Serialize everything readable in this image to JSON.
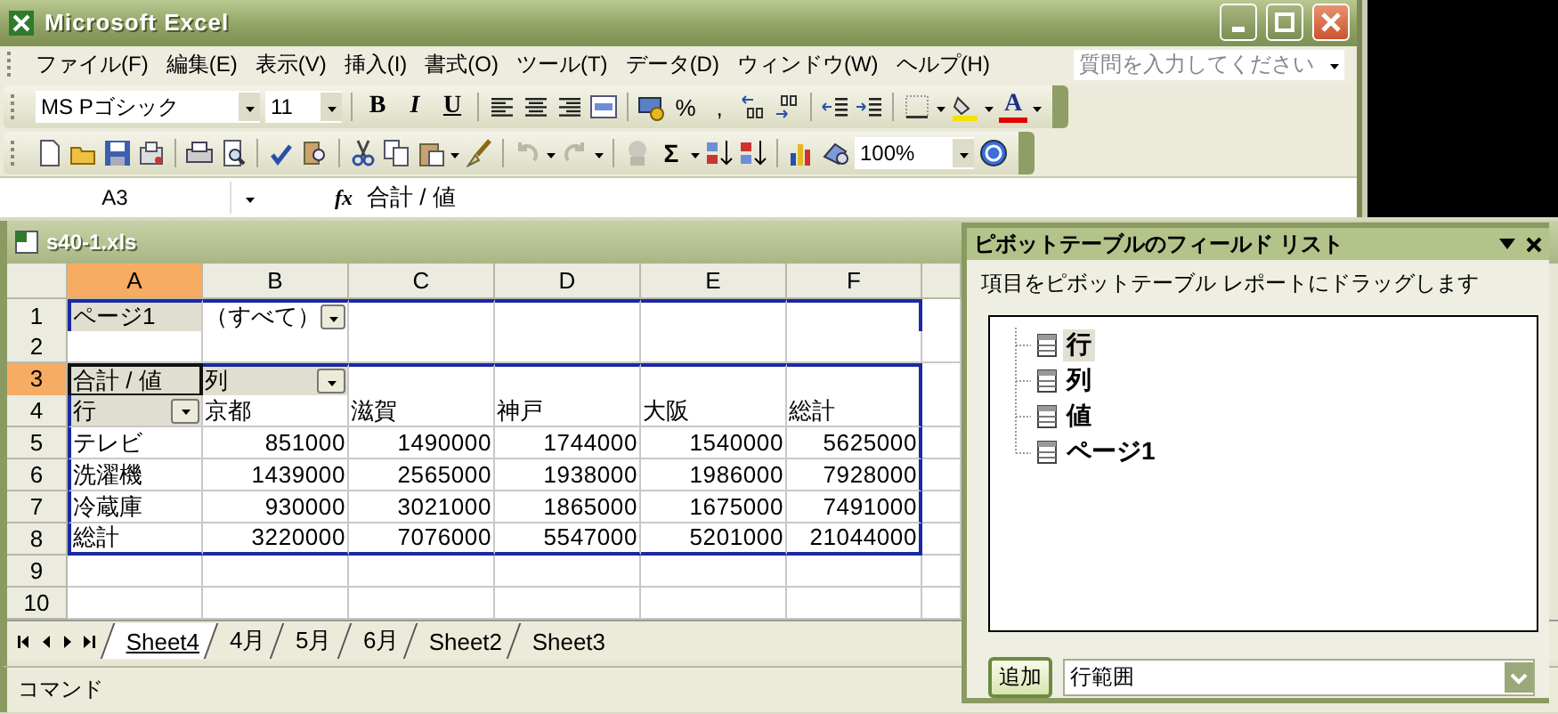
{
  "window": {
    "title": "Microsoft Excel"
  },
  "menu": [
    "ファイル(F)",
    "編集(E)",
    "表示(V)",
    "挿入(I)",
    "書式(O)",
    "ツール(T)",
    "データ(D)",
    "ウィンドウ(W)",
    "ヘルプ(H)"
  ],
  "help_search": {
    "placeholder": "質問を入力してください"
  },
  "formatting_toolbar": {
    "font": "MS Pゴシック",
    "size": "11",
    "styles": [
      "B",
      "I",
      "U"
    ],
    "percent": "%",
    "comma": ",",
    "font_color": "A"
  },
  "standard_toolbar": {
    "sum": "Σ",
    "zoom": "100%"
  },
  "formula_bar": {
    "name_box": "A3",
    "function_label": "fx",
    "formula": "合計 / 値"
  },
  "workbook": {
    "title": "s40-1.xls",
    "columns": [
      {
        "label": "A",
        "selected": true
      },
      {
        "label": "B",
        "selected": false
      },
      {
        "label": "C",
        "selected": false
      },
      {
        "label": "D",
        "selected": false
      },
      {
        "label": "E",
        "selected": false
      },
      {
        "label": "F",
        "selected": false
      }
    ],
    "rows": [
      {
        "header": "1",
        "selected": false,
        "cells": [
          {
            "kind": "field",
            "text": "ページ1"
          },
          {
            "kind": "page_dropdown",
            "text": "（すべて）"
          },
          {
            "kind": "empty"
          },
          {
            "kind": "empty"
          },
          {
            "kind": "empty"
          },
          {
            "kind": "empty"
          }
        ]
      },
      {
        "header": "2",
        "selected": false,
        "cells": [
          {
            "kind": "empty"
          },
          {
            "kind": "empty"
          },
          {
            "kind": "empty"
          },
          {
            "kind": "empty"
          },
          {
            "kind": "empty"
          },
          {
            "kind": "empty"
          }
        ]
      },
      {
        "header": "3",
        "selected": true,
        "cells": [
          {
            "kind": "field",
            "text": "合計 / 値"
          },
          {
            "kind": "field_dropdown",
            "text": "列"
          },
          {
            "kind": "empty"
          },
          {
            "kind": "empty"
          },
          {
            "kind": "empty"
          },
          {
            "kind": "empty"
          }
        ]
      },
      {
        "header": "4",
        "selected": false,
        "cells": [
          {
            "kind": "field_dropdown",
            "text": "行"
          },
          {
            "kind": "label",
            "text": "京都"
          },
          {
            "kind": "label",
            "text": "滋賀"
          },
          {
            "kind": "label",
            "text": "神戸"
          },
          {
            "kind": "label",
            "text": "大阪"
          },
          {
            "kind": "label",
            "text": "総計"
          }
        ]
      },
      {
        "header": "5",
        "selected": false,
        "cells": [
          {
            "kind": "label",
            "text": "テレビ"
          },
          {
            "kind": "number",
            "text": "851000"
          },
          {
            "kind": "number",
            "text": "1490000"
          },
          {
            "kind": "number",
            "text": "1744000"
          },
          {
            "kind": "number",
            "text": "1540000"
          },
          {
            "kind": "number",
            "text": "5625000"
          }
        ]
      },
      {
        "header": "6",
        "selected": false,
        "cells": [
          {
            "kind": "label",
            "text": "洗濯機"
          },
          {
            "kind": "number",
            "text": "1439000"
          },
          {
            "kind": "number",
            "text": "2565000"
          },
          {
            "kind": "number",
            "text": "1938000"
          },
          {
            "kind": "number",
            "text": "1986000"
          },
          {
            "kind": "number",
            "text": "7928000"
          }
        ]
      },
      {
        "header": "7",
        "selected": false,
        "cells": [
          {
            "kind": "label",
            "text": "冷蔵庫"
          },
          {
            "kind": "number",
            "text": "930000"
          },
          {
            "kind": "number",
            "text": "3021000"
          },
          {
            "kind": "number",
            "text": "1865000"
          },
          {
            "kind": "number",
            "text": "1675000"
          },
          {
            "kind": "number",
            "text": "7491000"
          }
        ]
      },
      {
        "header": "8",
        "selected": false,
        "cells": [
          {
            "kind": "label",
            "text": "総計"
          },
          {
            "kind": "number",
            "text": "3220000"
          },
          {
            "kind": "number",
            "text": "7076000"
          },
          {
            "kind": "number",
            "text": "5547000"
          },
          {
            "kind": "number",
            "text": "5201000"
          },
          {
            "kind": "number",
            "text": "21044000"
          }
        ]
      },
      {
        "header": "9",
        "selected": false,
        "cells": [
          {
            "kind": "empty"
          },
          {
            "kind": "empty"
          },
          {
            "kind": "empty"
          },
          {
            "kind": "empty"
          },
          {
            "kind": "empty"
          },
          {
            "kind": "empty"
          }
        ]
      },
      {
        "header": "10",
        "selected": false,
        "cells": [
          {
            "kind": "empty"
          },
          {
            "kind": "empty"
          },
          {
            "kind": "empty"
          },
          {
            "kind": "empty"
          },
          {
            "kind": "empty"
          },
          {
            "kind": "empty"
          }
        ]
      }
    ]
  },
  "sheet_tabs": [
    {
      "label": "Sheet4",
      "selected": true
    },
    {
      "label": "4月",
      "selected": false
    },
    {
      "label": "5月",
      "selected": false
    },
    {
      "label": "6月",
      "selected": false
    },
    {
      "label": "Sheet2",
      "selected": false
    },
    {
      "label": "Sheet3",
      "selected": false
    }
  ],
  "status_bar": {
    "text": "コマンド"
  },
  "field_list": {
    "title": "ピボットテーブルのフィールド リスト",
    "hint": "項目をピボットテーブル レポートにドラッグします",
    "fields": [
      {
        "label": "行",
        "selected": true
      },
      {
        "label": "列",
        "selected": false
      },
      {
        "label": "値",
        "selected": false
      },
      {
        "label": "ページ1",
        "selected": false
      }
    ],
    "add_button": "追加",
    "area": {
      "value": "行範囲"
    }
  }
}
